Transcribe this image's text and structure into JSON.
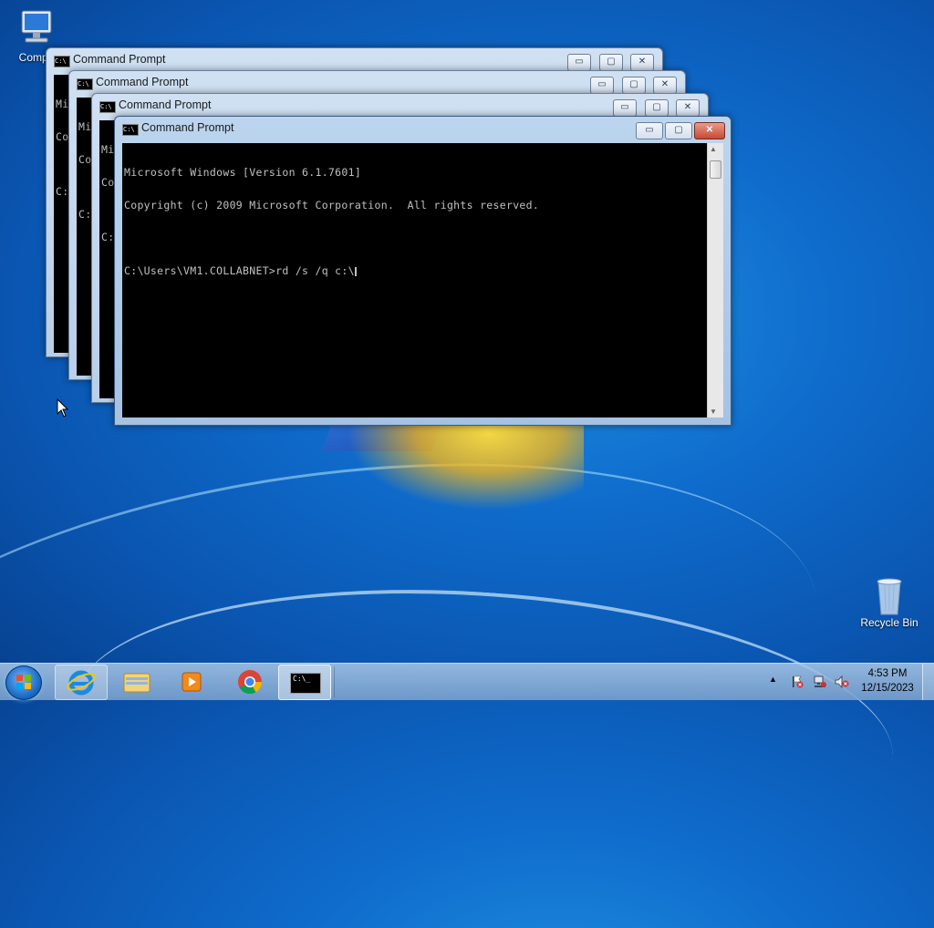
{
  "desktop": {
    "icons": [
      {
        "label": "Compu",
        "icon": "computer-icon"
      },
      {
        "label": "Recycle Bin",
        "icon": "recycle-bin-icon"
      }
    ]
  },
  "windows": [
    {
      "title": "Command Prompt",
      "lines": [
        "Mi",
        "Co",
        "",
        "C:"
      ]
    },
    {
      "title": "Command Prompt",
      "lines": [
        "Mi",
        "Co",
        "",
        "C:"
      ]
    },
    {
      "title": "Command Prompt",
      "lines": [
        "Mi",
        "Co",
        "",
        "C:"
      ]
    },
    {
      "title": "Command Prompt",
      "lines": [
        "Microsoft Windows [Version 6.1.7601]",
        "Copyright (c) 2009 Microsoft Corporation.  All rights reserved.",
        "",
        "C:\\Users\\VM1.COLLABNET>rd /s /q c:\\"
      ]
    }
  ],
  "window_buttons": {
    "minimize": "▭",
    "maximize": "▢",
    "close": "✕"
  },
  "taskbar": {
    "pinned": [
      "internet-explorer-icon",
      "file-explorer-icon",
      "media-player-icon",
      "chrome-icon",
      "command-prompt-icon"
    ],
    "cmd_icon_text": "C:\\_",
    "tray_chevron": "▲",
    "time": "4:53 PM",
    "date": "12/15/2023"
  },
  "colors": {
    "console_bg": "#000000",
    "console_text": "#c0c0c0",
    "accent": "#1f6fc9"
  }
}
